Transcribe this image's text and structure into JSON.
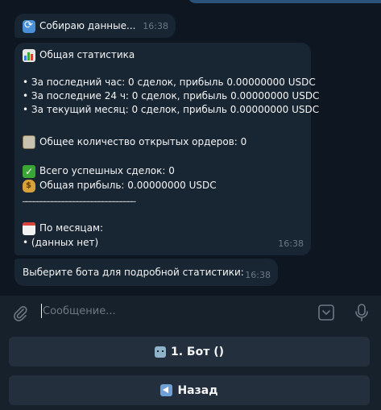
{
  "messages": [
    {
      "text": "Собираю данные...",
      "time": "16:38",
      "icon": "refresh-icon"
    },
    {
      "title": "Общая статистика",
      "lines": [
        "• За последний час: 0 сделок, прибыль 0.00000000 USDC",
        "• За последние 24 ч: 0 сделок, прибыль 0.00000000 USDC",
        "• За текущий месяц: 0 сделок, прибыль 0.00000000 USDC"
      ],
      "open_orders": "Общее количество открытых ордеров: 0",
      "successful": "Всего успешных сделок: 0",
      "total_profit": "Общая прибыль: 0.00000000 USDC",
      "divider": "_______________________________",
      "by_month": "По месяцам:",
      "no_data": "• (данных нет)",
      "time": "16:38"
    },
    {
      "text": "Выберите бота для подробной статистики:",
      "time": "16:38"
    }
  ],
  "composer": {
    "placeholder": "Сообщение..."
  },
  "keyboard": [
    {
      "label": "1. Бот ()",
      "icon": "robot-icon"
    },
    {
      "label": "Назад",
      "icon": "back-arrow-icon"
    }
  ],
  "colors": {
    "background": "#0e1621",
    "bubble_in": "#182533",
    "bubble_out": "#2b5278",
    "panel": "#17212b",
    "button": "#242f3d",
    "timestamp": "#6c7883"
  }
}
